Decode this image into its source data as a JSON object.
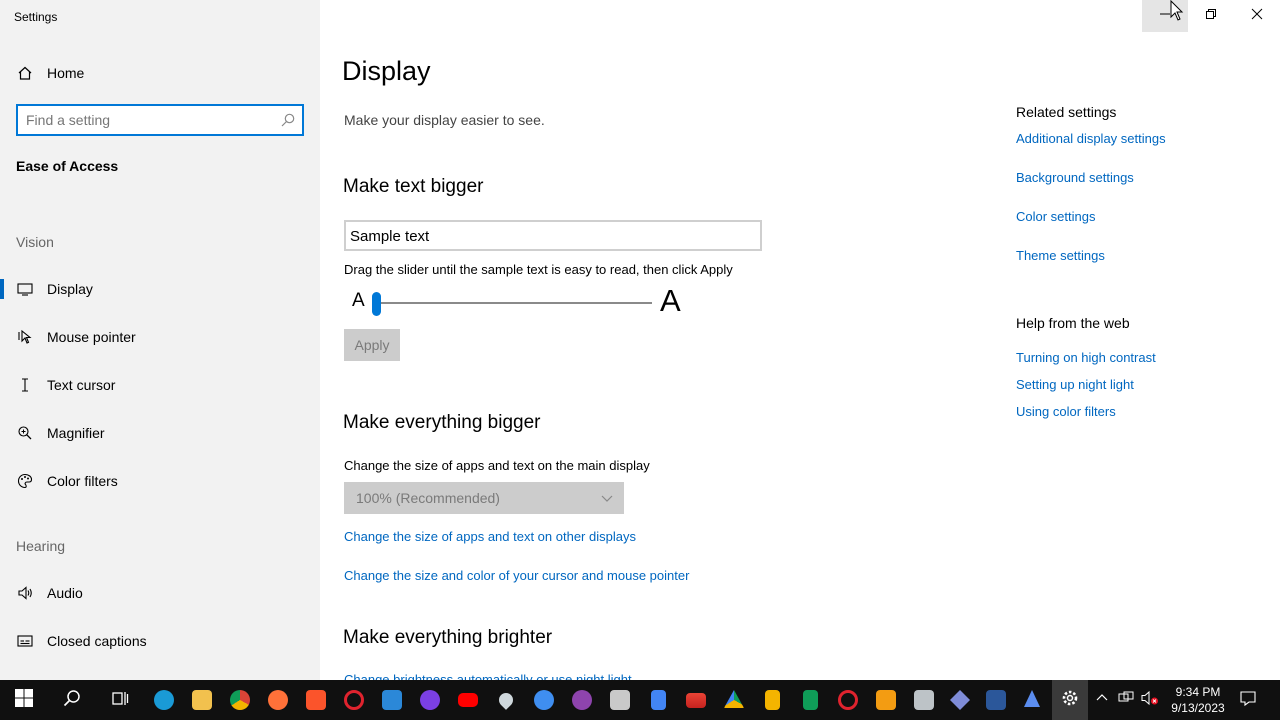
{
  "window": {
    "app_title": "Settings",
    "minimize_icon": "minimize-icon",
    "maximize_icon": "restore-icon",
    "close_icon": "close-icon"
  },
  "sidebar": {
    "home_label": "Home",
    "search_placeholder": "Find a setting",
    "search_value": "",
    "category": "Ease of Access",
    "groups": [
      {
        "title": "Vision",
        "items": [
          {
            "label": "Display",
            "icon": "monitor-icon",
            "active": true
          },
          {
            "label": "Mouse pointer",
            "icon": "mouse-pointer-icon"
          },
          {
            "label": "Text cursor",
            "icon": "text-cursor-icon"
          },
          {
            "label": "Magnifier",
            "icon": "magnifier-icon"
          },
          {
            "label": "Color filters",
            "icon": "color-filters-icon"
          }
        ]
      },
      {
        "title": "Hearing",
        "items": [
          {
            "label": "Audio",
            "icon": "speaker-icon"
          },
          {
            "label": "Closed captions",
            "icon": "closed-captions-icon"
          }
        ]
      }
    ]
  },
  "main": {
    "title": "Display",
    "subtitle": "Make your display easier to see.",
    "text_bigger": {
      "heading": "Make text bigger",
      "sample_text": "Sample text",
      "hint": "Drag the slider until the sample text is easy to read, then click Apply",
      "small_a": "A",
      "big_a": "A",
      "slider_value_percent": 0,
      "apply_label": "Apply"
    },
    "everything_bigger": {
      "heading": "Make everything bigger",
      "description": "Change the size of apps and text on the main display",
      "dropdown_value": "100% (Recommended)",
      "link_other_displays": "Change the size of apps and text on other displays",
      "link_cursor": "Change the size and color of your cursor and mouse pointer"
    },
    "everything_brighter": {
      "heading": "Make everything brighter",
      "link_brightness": "Change brightness automatically or use night light"
    }
  },
  "related": {
    "heading": "Related settings",
    "links": [
      "Additional display settings",
      "Background settings",
      "Color settings",
      "Theme settings"
    ]
  },
  "help": {
    "heading": "Help from the web",
    "links": [
      "Turning on high contrast",
      "Setting up night light",
      "Using color filters"
    ]
  },
  "taskbar": {
    "time": "9:34 PM",
    "date": "9/13/2023",
    "colors": {
      "accent": "#0078d7",
      "link": "#0067c0",
      "taskbar": "#101010"
    }
  }
}
